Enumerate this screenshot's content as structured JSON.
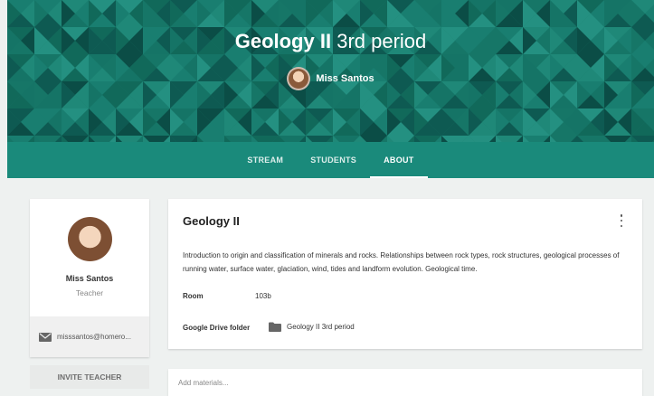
{
  "header": {
    "course_title_bold": "Geology II",
    "course_title_rest": "3rd period",
    "teacher_name": "Miss Santos",
    "color": "#1b8577"
  },
  "tabs": [
    {
      "label": "STREAM",
      "active": false
    },
    {
      "label": "STUDENTS",
      "active": false
    },
    {
      "label": "ABOUT",
      "active": true
    }
  ],
  "profile": {
    "name": "Miss Santos",
    "role": "Teacher",
    "email": "misssantos@homero...",
    "icon": "mail-icon"
  },
  "invite_button": "INVITE TEACHER",
  "about": {
    "title": "Geology II",
    "description": "Introduction to origin and classification of minerals and rocks. Relationships between rock types, rock structures, geological processes of running water, surface water, glaciation, wind, tides and landform evolution. Geological time.",
    "room_label": "Room",
    "room_value": "103b",
    "drive_label": "Google Drive folder",
    "drive_folder": "Geology II 3rd period"
  },
  "materials_placeholder": "Add materials..."
}
